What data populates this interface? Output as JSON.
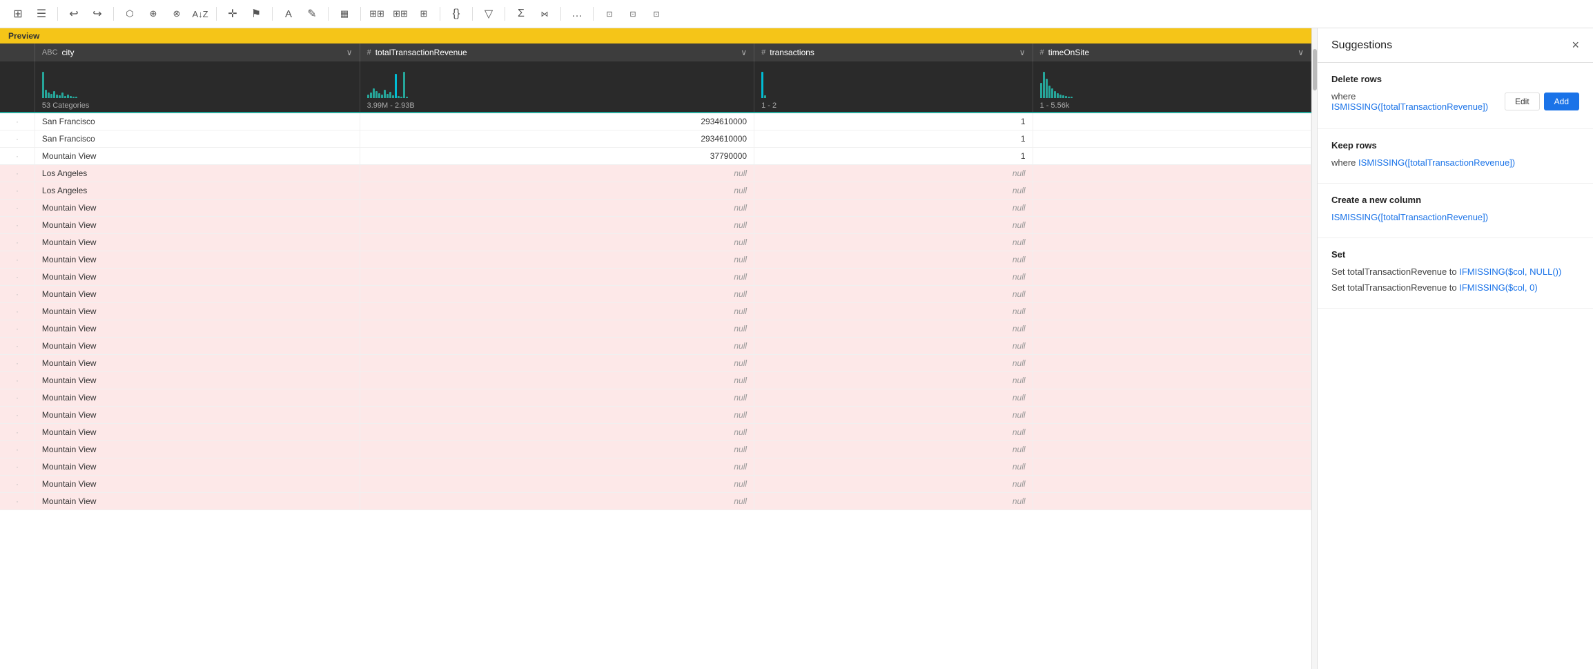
{
  "toolbar": {
    "icons": [
      {
        "name": "grid-icon",
        "symbol": "⊞"
      },
      {
        "name": "menu-icon",
        "symbol": "☰"
      },
      {
        "name": "undo-icon",
        "symbol": "↩"
      },
      {
        "name": "redo-icon",
        "symbol": "↪"
      },
      {
        "name": "transform1-icon",
        "symbol": "⊞"
      },
      {
        "name": "transform2-icon",
        "symbol": "⊞"
      },
      {
        "name": "transform3-icon",
        "symbol": "⊞"
      },
      {
        "name": "sort-icon",
        "symbol": "⇅"
      },
      {
        "name": "move-icon",
        "symbol": "✛"
      },
      {
        "name": "flag-icon",
        "symbol": "⚑"
      },
      {
        "name": "text-icon",
        "symbol": "A"
      },
      {
        "name": "edit1-icon",
        "symbol": "✎"
      },
      {
        "name": "table-icon",
        "symbol": "▦"
      },
      {
        "name": "formula1-icon",
        "symbol": "∑"
      },
      {
        "name": "formula2-icon",
        "symbol": "⊞"
      },
      {
        "name": "formula3-icon",
        "symbol": "⊞"
      },
      {
        "name": "braces-icon",
        "symbol": "{}"
      },
      {
        "name": "filter-icon",
        "symbol": "▽"
      },
      {
        "name": "sigma-icon",
        "symbol": "Σ"
      },
      {
        "name": "merge-icon",
        "symbol": "⋈"
      },
      {
        "name": "more-icon",
        "symbol": "…"
      },
      {
        "name": "view1-icon",
        "symbol": "⊡"
      },
      {
        "name": "view2-icon",
        "symbol": "⊡"
      },
      {
        "name": "view3-icon",
        "symbol": "⊡"
      }
    ]
  },
  "preview": {
    "label": "Preview"
  },
  "columns": [
    {
      "id": "row-indicator",
      "label": "",
      "type": ""
    },
    {
      "id": "city",
      "label": "city",
      "type": "ABC"
    },
    {
      "id": "totalTransactionRevenue",
      "label": "totalTransactionRevenue",
      "type": "#"
    },
    {
      "id": "transactions",
      "label": "transactions",
      "type": "#"
    },
    {
      "id": "timeOnSite",
      "label": "timeOnSite",
      "type": "#"
    }
  ],
  "stats": {
    "city": "53 Categories",
    "totalTransactionRevenue": "3.99M - 2.93B",
    "transactions": "1 - 2",
    "timeOnSite": "1 - 5.56k"
  },
  "rows": [
    {
      "indicator": "·",
      "city": "San Francisco",
      "revenue": "2934610000",
      "transactions": "1",
      "timeOnSite": "",
      "highlighted": false
    },
    {
      "indicator": "·",
      "city": "San Francisco",
      "revenue": "2934610000",
      "transactions": "1",
      "timeOnSite": "",
      "highlighted": false
    },
    {
      "indicator": "·",
      "city": "Mountain View",
      "revenue": "37790000",
      "transactions": "1",
      "timeOnSite": "",
      "highlighted": false
    },
    {
      "indicator": "·",
      "city": "Los Angeles",
      "revenue": "null",
      "transactions": "null",
      "timeOnSite": "",
      "highlighted": true
    },
    {
      "indicator": "·",
      "city": "Los Angeles",
      "revenue": "null",
      "transactions": "null",
      "timeOnSite": "",
      "highlighted": true
    },
    {
      "indicator": "·",
      "city": "Mountain View",
      "revenue": "null",
      "transactions": "null",
      "timeOnSite": "",
      "highlighted": true
    },
    {
      "indicator": "·",
      "city": "Mountain View",
      "revenue": "null",
      "transactions": "null",
      "timeOnSite": "",
      "highlighted": true
    },
    {
      "indicator": "·",
      "city": "Mountain View",
      "revenue": "null",
      "transactions": "null",
      "timeOnSite": "",
      "highlighted": true
    },
    {
      "indicator": "·",
      "city": "Mountain View",
      "revenue": "null",
      "transactions": "null",
      "timeOnSite": "",
      "highlighted": true
    },
    {
      "indicator": "·",
      "city": "Mountain View",
      "revenue": "null",
      "transactions": "null",
      "timeOnSite": "",
      "highlighted": true
    },
    {
      "indicator": "·",
      "city": "Mountain View",
      "revenue": "null",
      "transactions": "null",
      "timeOnSite": "",
      "highlighted": true
    },
    {
      "indicator": "·",
      "city": "Mountain View",
      "revenue": "null",
      "transactions": "null",
      "timeOnSite": "",
      "highlighted": true
    },
    {
      "indicator": "·",
      "city": "Mountain View",
      "revenue": "null",
      "transactions": "null",
      "timeOnSite": "",
      "highlighted": true
    },
    {
      "indicator": "·",
      "city": "Mountain View",
      "revenue": "null",
      "transactions": "null",
      "timeOnSite": "",
      "highlighted": true
    },
    {
      "indicator": "·",
      "city": "Mountain View",
      "revenue": "null",
      "transactions": "null",
      "timeOnSite": "",
      "highlighted": true
    },
    {
      "indicator": "·",
      "city": "Mountain View",
      "revenue": "null",
      "transactions": "null",
      "timeOnSite": "",
      "highlighted": true
    },
    {
      "indicator": "·",
      "city": "Mountain View",
      "revenue": "null",
      "transactions": "null",
      "timeOnSite": "",
      "highlighted": true
    },
    {
      "indicator": "·",
      "city": "Mountain View",
      "revenue": "null",
      "transactions": "null",
      "timeOnSite": "",
      "highlighted": true
    },
    {
      "indicator": "·",
      "city": "Mountain View",
      "revenue": "null",
      "transactions": "null",
      "timeOnSite": "",
      "highlighted": true
    },
    {
      "indicator": "·",
      "city": "Mountain View",
      "revenue": "null",
      "transactions": "null",
      "timeOnSite": "",
      "highlighted": true
    },
    {
      "indicator": "·",
      "city": "Mountain View",
      "revenue": "null",
      "transactions": "null",
      "timeOnSite": "",
      "highlighted": true
    },
    {
      "indicator": "·",
      "city": "Mountain View",
      "revenue": "null",
      "transactions": "null",
      "timeOnSite": "",
      "highlighted": true
    },
    {
      "indicator": "·",
      "city": "Mountain View",
      "revenue": "null",
      "transactions": "null",
      "timeOnSite": "",
      "highlighted": true
    }
  ],
  "suggestions": {
    "title": "Suggestions",
    "close_label": "×",
    "sections": [
      {
        "id": "delete-rows",
        "title": "Delete rows",
        "items": [
          {
            "text_before": "where ",
            "link": "ISMISSING([totalTransactionRevenue])",
            "text_after": "",
            "has_actions": true,
            "edit_label": "Edit",
            "add_label": "Add"
          }
        ]
      },
      {
        "id": "keep-rows",
        "title": "Keep rows",
        "items": [
          {
            "text_before": "where ",
            "link": "ISMISSING([totalTransactionRevenue])",
            "text_after": "",
            "has_actions": false
          }
        ]
      },
      {
        "id": "create-column",
        "title": "Create a new column",
        "items": [
          {
            "text_before": "",
            "link": "ISMISSING([totalTransactionRevenue])",
            "text_after": "",
            "has_actions": false
          }
        ]
      },
      {
        "id": "set",
        "title": "Set",
        "items": [
          {
            "text_before": "Set totalTransactionRevenue to ",
            "link": "IFMISSING($col, NULL())",
            "text_after": "",
            "has_actions": false
          },
          {
            "text_before": "Set totalTransactionRevenue to ",
            "link": "IFMISSING($col, 0)",
            "text_after": "",
            "has_actions": false
          }
        ]
      }
    ]
  }
}
